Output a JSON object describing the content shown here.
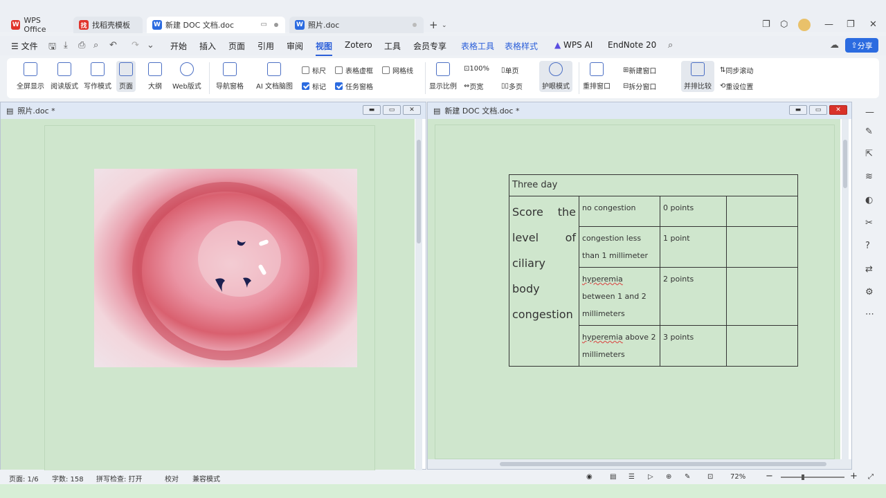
{
  "tabs": [
    {
      "label": "WPS Office",
      "logo": "W"
    },
    {
      "label": "找稻壳模板",
      "logo": "找"
    },
    {
      "label": "新建 DOC 文档.doc",
      "logo": "W"
    },
    {
      "label": "照片.doc",
      "logo": "W"
    }
  ],
  "menu": {
    "file": "文件",
    "start": "开始",
    "insert": "插入",
    "page": "页面",
    "reference": "引用",
    "review": "审阅",
    "view": "视图",
    "zotero": "Zotero",
    "tools": "工具",
    "member": "会员专享",
    "table_tools": "表格工具",
    "table_style": "表格样式",
    "wps_ai": "WPS AI",
    "endnote": "EndNote 20"
  },
  "share_label": "分享",
  "ribbon": {
    "fullscreen": "全屏显示",
    "reading": "阅读版式",
    "writing": "写作模式",
    "page_view": "页面",
    "outline": "大纲",
    "web": "Web版式",
    "nav_pane": "导航窗格",
    "ai_map": "AI 文档脑图",
    "ruler": "标尺",
    "table_gridlines": "表格虚框",
    "gridlines": "网格线",
    "marks": "标记",
    "task_pane": "任务窗格",
    "zoom_ratio": "显示比例",
    "zoom_100": "100%",
    "page_width": "页宽",
    "single_page": "单页",
    "multi_page": "多页",
    "eye_mode": "护眼模式",
    "rearrange": "重排窗口",
    "new_window": "新建窗口",
    "split_window": "拆分窗口",
    "side_by_side": "并排比较",
    "sync_scroll": "同步滚动",
    "reset_position": "重设位置"
  },
  "left_window": {
    "title": "照片.doc *"
  },
  "right_window": {
    "title": "新建 DOC 文档.doc *"
  },
  "table": {
    "header": "Three day",
    "label": "Score the level of ciliary body congestion",
    "rows": [
      {
        "desc": "no congestion",
        "score": "0 points"
      },
      {
        "desc": "congestion less than 1 millimeter",
        "score": "1 point"
      },
      {
        "desc_a": "hyperemia",
        "desc_b": " between 1 and 2 millimeters",
        "score": "2 points"
      },
      {
        "desc_a": "hyperemia",
        "desc_b": " above 2 millimeters",
        "score": "3 points"
      }
    ]
  },
  "status": {
    "page": "页面: 1/6",
    "words": "字数: 158",
    "spell": "拼写检查: 打开",
    "proof": "校对",
    "compat": "兼容模式",
    "zoom": "72%"
  },
  "colors": {
    "accent": "#2b6be0",
    "eye_green": "#cfe6cd",
    "wps_red": "#e0342c",
    "word_blue": "#2b6be0"
  }
}
